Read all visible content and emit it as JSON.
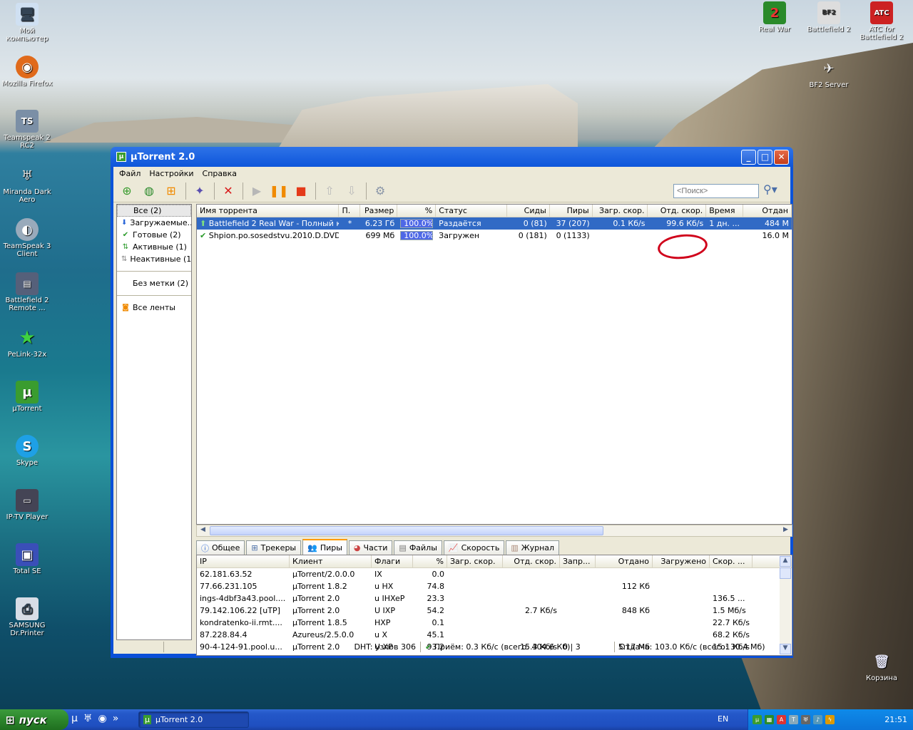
{
  "desktop": {
    "icons_left": [
      {
        "label": "Мой компьютер",
        "icon": "my-computer-icon"
      },
      {
        "label": "Mozilla Firefox",
        "icon": "firefox-icon"
      },
      {
        "label": "Teamspeak 2 RC2",
        "icon": "teamspeak-icon"
      },
      {
        "label": "Miranda Dark Aero",
        "icon": "miranda-icon"
      },
      {
        "label": "TeamSpeak 3 Client",
        "icon": "teamspeak3-icon"
      },
      {
        "label": "Battlefield 2 Remote ...",
        "icon": "bf2-remote-icon"
      },
      {
        "label": "PeLink-32x",
        "icon": "star-icon"
      },
      {
        "label": "µTorrent",
        "icon": "utorrent-icon"
      },
      {
        "label": "Skype",
        "icon": "skype-icon"
      },
      {
        "label": "IP-TV Player",
        "icon": "iptv-icon"
      },
      {
        "label": "Total SE",
        "icon": "floppy-icon"
      },
      {
        "label": "SAMSUNG Dr.Printer",
        "icon": "printer-icon"
      }
    ],
    "icons_right": [
      {
        "label": "Real War",
        "icon": "real-war-icon"
      },
      {
        "label": "Battlefield 2",
        "icon": "bf2-icon"
      },
      {
        "label": "ATC for Battlefield 2",
        "icon": "atc-icon"
      },
      {
        "label": "BF2 Server",
        "icon": "bf2-server-icon"
      },
      {
        "label": "Корзина",
        "icon": "recycle-bin-icon"
      }
    ]
  },
  "window": {
    "title": "µTorrent 2.0",
    "menu": [
      "Файл",
      "Настройки",
      "Справка"
    ],
    "search_placeholder": "<Поиск>"
  },
  "sidebar": {
    "items": [
      {
        "label": "Все (2)"
      },
      {
        "label": "Загружаемые..."
      },
      {
        "label": "Готовые (2)"
      },
      {
        "label": "Активные (1)"
      },
      {
        "label": "Неактивные (1)"
      }
    ],
    "labels": "Без метки (2)",
    "feeds": "Все ленты"
  },
  "torrents": {
    "columns": [
      "Имя торрента",
      "П.",
      "Размер",
      "%",
      "Статус",
      "Сиды",
      "Пиры",
      "Загр. скор.",
      "Отд. скор.",
      "Время",
      "Отдан"
    ],
    "rows": [
      {
        "name": "Battlefield 2 Real War - Полный к...",
        "prio": "*",
        "size": "6.23 Гб",
        "pct": "100.0%",
        "status": "Раздаётся",
        "seeds": "0 (81)",
        "peers": "37 (207)",
        "down": "0.1 Кб/s",
        "up": "99.6 Кб/s",
        "time": "1 дн. ...",
        "uploaded": "484 M"
      },
      {
        "name": "Shpion.po.sosedstvu.2010.D.DVD...",
        "prio": "",
        "size": "699 Мб",
        "pct": "100.0%",
        "status": "Загружен",
        "seeds": "0 (181)",
        "peers": "0 (1133)",
        "down": "",
        "up": "",
        "time": "",
        "uploaded": "16.0 M"
      }
    ]
  },
  "tabs": [
    "Общее",
    "Трекеры",
    "Пиры",
    "Части",
    "Файлы",
    "Скорость",
    "Журнал"
  ],
  "peers": {
    "columns": [
      "IP",
      "Клиент",
      "Флаги",
      "%",
      "Загр. скор.",
      "Отд. скор.",
      "Запр...",
      "Отдано",
      "Загружено",
      "Скор. ..."
    ],
    "rows": [
      {
        "ip": "62.181.63.52",
        "client": "µTorrent/2.0.0.0",
        "flags": "IX",
        "pct": "0.0",
        "down": "",
        "up": "",
        "req": "",
        "sent": "",
        "recv": "",
        "speed": ""
      },
      {
        "ip": "77.66.231.105",
        "client": "µTorrent 1.8.2",
        "flags": "u HX",
        "pct": "74.8",
        "down": "",
        "up": "",
        "req": "",
        "sent": "112 Кб",
        "recv": "",
        "speed": ""
      },
      {
        "ip": "ings-4dbf3a43.pool....",
        "client": "µTorrent 2.0",
        "flags": "u IHXeP",
        "pct": "23.3",
        "down": "",
        "up": "",
        "req": "",
        "sent": "",
        "recv": "",
        "speed": "136.5 ..."
      },
      {
        "ip": "79.142.106.22 [uTP]",
        "client": "µTorrent 2.0",
        "flags": "U IXP",
        "pct": "54.2",
        "down": "",
        "up": "2.7 Кб/s",
        "req": "",
        "sent": "848 Кб",
        "recv": "",
        "speed": "1.5 Мб/s"
      },
      {
        "ip": "kondratenko-ii.rmt....",
        "client": "µTorrent 1.8.5",
        "flags": "HXP",
        "pct": "0.1",
        "down": "",
        "up": "",
        "req": "",
        "sent": "",
        "recv": "",
        "speed": "22.7 Кб/s"
      },
      {
        "ip": "87.228.84.4",
        "client": "Azureus/2.5.0.0",
        "flags": "u X",
        "pct": "45.1",
        "down": "",
        "up": "",
        "req": "",
        "sent": "",
        "recv": "",
        "speed": "68.2 Кб/s"
      },
      {
        "ip": "90-4-124-91.pool.u...",
        "client": "µTorrent 2.0",
        "flags": "U XP",
        "pct": "93.2",
        "down": "",
        "up": "15.3 Кб/s",
        "req": "0 | 3",
        "sent": "5.17 Мб",
        "recv": "",
        "speed": "15.1 Кб/s"
      }
    ]
  },
  "status": {
    "dht": "DHT: узлов 306",
    "recv": "Приём: 0.3 Кб/с (всего: 404.6 Кб)",
    "send": "Отдача: 103.0 Кб/с (всего: 30.4 Мб)"
  },
  "taskbar": {
    "start": "пуск",
    "task": "µTorrent 2.0",
    "lang": "EN",
    "clock": "21:51"
  }
}
